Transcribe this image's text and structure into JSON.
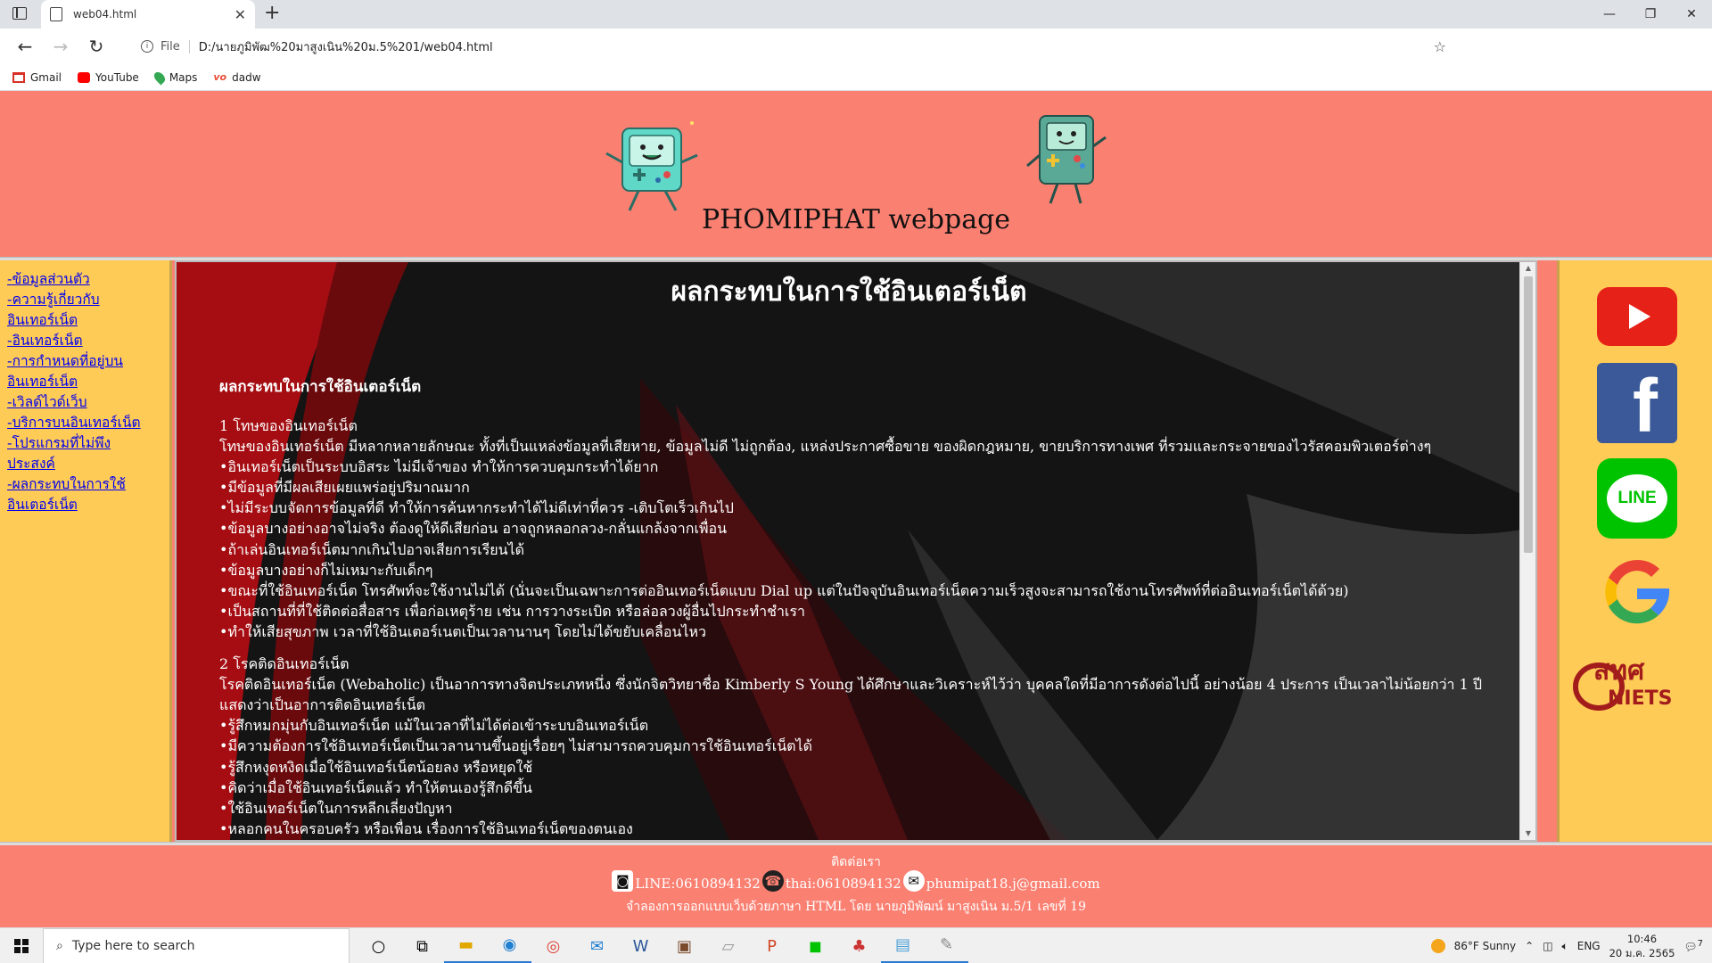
{
  "browser": {
    "tab_title": "web04.html",
    "tab_close": "✕",
    "new_tab": "+",
    "window_controls": [
      "—",
      "❐",
      "✕"
    ],
    "nav": {
      "back": "←",
      "forward": "→",
      "refresh": "↻"
    },
    "url_scheme_label": "File",
    "url": "D:/นายภูมิพัฒ%20มาสูงเนิน%20ม.5%201/web04.html",
    "bookmarks": [
      "Gmail",
      "YouTube",
      "Maps",
      "dadw"
    ],
    "toolbar_icons": [
      "collections-icon",
      "extensions-icon",
      "favorites-icon",
      "tabs-icon",
      "profile-icon",
      "more-icon"
    ]
  },
  "page": {
    "site_title": "PHOMIPHAT webpage",
    "nav_links": [
      "-ข้อมูลส่วนตัว",
      "-ความรู้เกี่ยวกับ",
      "อินเทอร์เน็ต",
      "-อินเทอร์เน็ต",
      "-การกำหนดที่อยู่บน",
      "อินเทอร์เน็ต",
      "-เวิลด์ไวด์เว็บ",
      "-บริการบนอินเทอร์เน็ต",
      "-โปรแกรมที่ไม่พึง",
      "ประสงค์",
      "-ผลกระทบในการใช้",
      "อินเตอร์เน็ต"
    ],
    "content": {
      "title": "ผลกระทบในการใช้อินเตอร์เน็ต",
      "section_heading": "ผลกระทบในการใช้อินเตอร์เน็ต",
      "lines": [
        "1 โทษของอินเทอร์เน็ต",
        "โทษของอินเทอร์เน็ต มีหลากหลายลักษณะ ทั้งที่เป็นแหล่งข้อมูลที่เสียหาย, ข้อมูลไม่ดี ไม่ถูกต้อง, แหล่งประกาศซื้อขาย ของผิดกฎหมาย, ขายบริการทางเพศ ที่รวมและกระจายของไวรัสคอมพิวเตอร์ต่างๆ",
        "•อินเทอร์เน็ตเป็นระบบอิสระ ไม่มีเจ้าของ ทำให้การควบคุมกระทำได้ยาก",
        "•มีข้อมูลที่มีผลเสียเผยแพร่อยู่ปริมาณมาก",
        "•ไม่มีระบบจัดการข้อมูลที่ดี ทำให้การค้นหากระทำได้ไม่ดีเท่าที่ควร -เติบโตเร็วเกินไป",
        "•ข้อมูลบางอย่างอาจไม่จริง ต้องดูให้ดีเสียก่อน อาจถูกหลอกลวง-กลั่นแกล้งจากเพื่อน",
        "•ถ้าเล่นอินเทอร์เน็ตมากเกินไปอาจเสียการเรียนได้",
        "•ข้อมูลบางอย่างก็ไม่เหมาะกับเด็กๆ",
        "•ขณะที่ใช้อินเทอร์เน็ต โทรศัพท์จะใช้งานไม่ได้ (นั่นจะเป็นเฉพาะการต่ออินเทอร์เน็ตแบบ Dial up แต่ในปัจจุบันอินเทอร์เน็ตความเร็วสูงจะสามารถใช้งานโทรศัพท์ที่ต่ออินเทอร์เน็ตได้ด้วย)",
        "•เป็นสถานที่ที่ใช้ติดต่อสื่อสาร เพื่อก่อเหตุร้าย เช่น การวางระเบิด หรือล่อลวงผู้อื่นไปกระทำชำเรา",
        "•ทำให้เสียสุขภาพ เวลาที่ใช้อินเตอร์เนตเป็นเวลานานๆ โดยไม่ได้ขยับเคลื่อนไหว",
        "",
        "2 โรคติดอินเทอร์เน็ต",
        "โรคติดอินเทอร์เน็ต (Webaholic) เป็นอาการทางจิตประเภทหนึ่ง ซึ่งนักจิตวิทยาชื่อ Kimberly S Young ได้ศึกษาและวิเคราะห์ไว้ว่า บุคคลใดที่มีอาการดังต่อไปนี้ อย่างน้อย 4 ประการ เป็นเวลาไม่น้อยกว่า 1 ปี",
        "แสดงว่าเป็นอาการติดอินเทอร์เน็ต",
        "•รู้สึกหมกมุ่นกับอินเทอร์เน็ต แม้ในเวลาที่ไม่ได้ต่อเข้าระบบอินเทอร์เน็ต",
        "•มีความต้องการใช้อินเทอร์เน็ตเป็นเวลานานขึ้นอยู่เรื่อยๆ ไม่สามารถควบคุมการใช้อินเทอร์เน็ตได้",
        "•รู้สึกหงุดหงิดเมื่อใช้อินเทอร์เน็ตน้อยลง หรือหยุดใช้",
        "•คิดว่าเมื่อใช้อินเทอร์เน็ตแล้ว ทำให้ตนเองรู้สึกดีขึ้น",
        "•ใช้อินเทอร์เน็ตในการหลีกเลี่ยงปัญหา",
        "•หลอกคนในครอบครัว หรือเพื่อน เรื่องการใช้อินเทอร์เน็ตของตนเอง"
      ]
    },
    "social": {
      "youtube": "youtube-icon",
      "facebook": "f",
      "line": "LINE",
      "google": "google-icon",
      "niets": "NIETS",
      "niets_thai": "สทศ"
    },
    "footer": {
      "contact_title": "ติดต่อเรา",
      "line_contact": "LINE:0610894132",
      "phone_contact": "thai:0610894132",
      "email_contact": "phumipat18.j@gmail.com",
      "credit": "จำลองการออกแบบเว็บด้วยภาษา HTML โดย นายภูมิพัฒน์ มาสูงเนิน ม.5/1 เลขที่ 19"
    }
  },
  "taskbar": {
    "search_placeholder": "Type here to search",
    "weather": "86°F  Sunny",
    "language": "ENG",
    "time": "10:46",
    "date": "20 ม.ค. 2565",
    "notification_count": "7"
  },
  "colors": {
    "header_bg": "#fa8072",
    "sidebar_bg": "#ffcb57",
    "content_bg": "#111111",
    "accent_red": "#a50d12"
  }
}
